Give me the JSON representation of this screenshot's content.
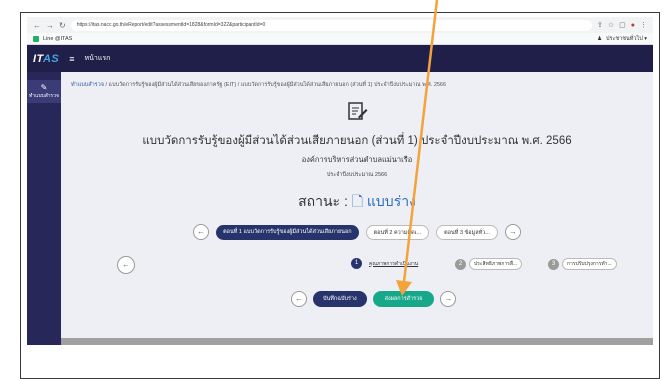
{
  "browser": {
    "url": "https://itas.nacc.go.th/eReport/edit?assessmentId=1828&formId=322&participantId=0",
    "bookmark": "Line @ITAS",
    "bookmark_right": "ประชาชนทั่วไป ▾"
  },
  "app": {
    "logo_main": "IT",
    "logo_accent": "AS",
    "menu_label": "หน้าแรก",
    "sidebar_item": "ทำแบบสำรวจ"
  },
  "breadcrumb": {
    "link": "ทำแบบสำรวจ",
    "rest": " / แบบวัดการรับรู้ของผู้มีส่วนได้ส่วนเสียของภาครัฐ (EIT) / แบบวัดการรับรู้ของผู้มีส่วนได้ส่วนเสียภายนอก (ส่วนที่ 1) ประจำปีงบประมาณ พ.ศ. 2566"
  },
  "form": {
    "title": "แบบวัดการรับรู้ของผู้มีส่วนได้ส่วนเสียภายนอก (ส่วนที่ 1) ประจำปีงบประมาณ พ.ศ. 2566",
    "org": "องค์การบริหารส่วนตำบลแม่นาเรือ",
    "year": "ประจำปีงบประมาณ 2566",
    "status_label": "สถานะ :",
    "status_value": "แบบร่าง"
  },
  "parts": [
    {
      "label": "ตอนที่ 1 แบบวัดการรับรู้ของผู้มีส่วนได้ส่วนเสียภายนอก"
    },
    {
      "label": "ตอนที่ 2 ความคิดเ..."
    },
    {
      "label": "ตอนที่ 3 ข้อมูลทั่ว..."
    }
  ],
  "sections": [
    {
      "num": "1",
      "label": "คุณภาพการดำเนินงาน"
    },
    {
      "num": "2",
      "label": "ประสิทธิภาพการสื..."
    },
    {
      "num": "3",
      "label": "การปรับปรุงการทำ..."
    }
  ],
  "actions": {
    "save": "บันทึกฉบับร่าง",
    "submit": "ส่งผลการสำรวจ"
  },
  "colors": {
    "header": "#1f1f4a",
    "primary": "#27336b",
    "submit": "#17a88a",
    "annotation": "#f4a23a"
  }
}
